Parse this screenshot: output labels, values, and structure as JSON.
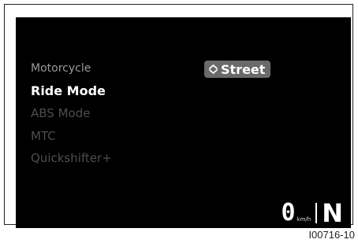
{
  "menu": {
    "items": [
      {
        "label": "Motorcycle",
        "state": "header"
      },
      {
        "label": "Ride Mode",
        "state": "active"
      },
      {
        "label": "ABS Mode",
        "state": "dim"
      },
      {
        "label": "MTC",
        "state": "dim"
      },
      {
        "label": "Quickshifter+",
        "state": "dim"
      }
    ]
  },
  "selector": {
    "icon": "up-down-arrows-icon",
    "value": "Street"
  },
  "status": {
    "speed": "0",
    "speed_unit": "km/h",
    "gear": "N"
  },
  "figure": {
    "reference_code": "I00716-10"
  },
  "colors": {
    "screen_bg": "#000000",
    "selector_bg": "#6a6a6a",
    "text_active": "#ffffff",
    "text_header": "#9a9a9a",
    "text_dim": "#4e4e4e"
  }
}
